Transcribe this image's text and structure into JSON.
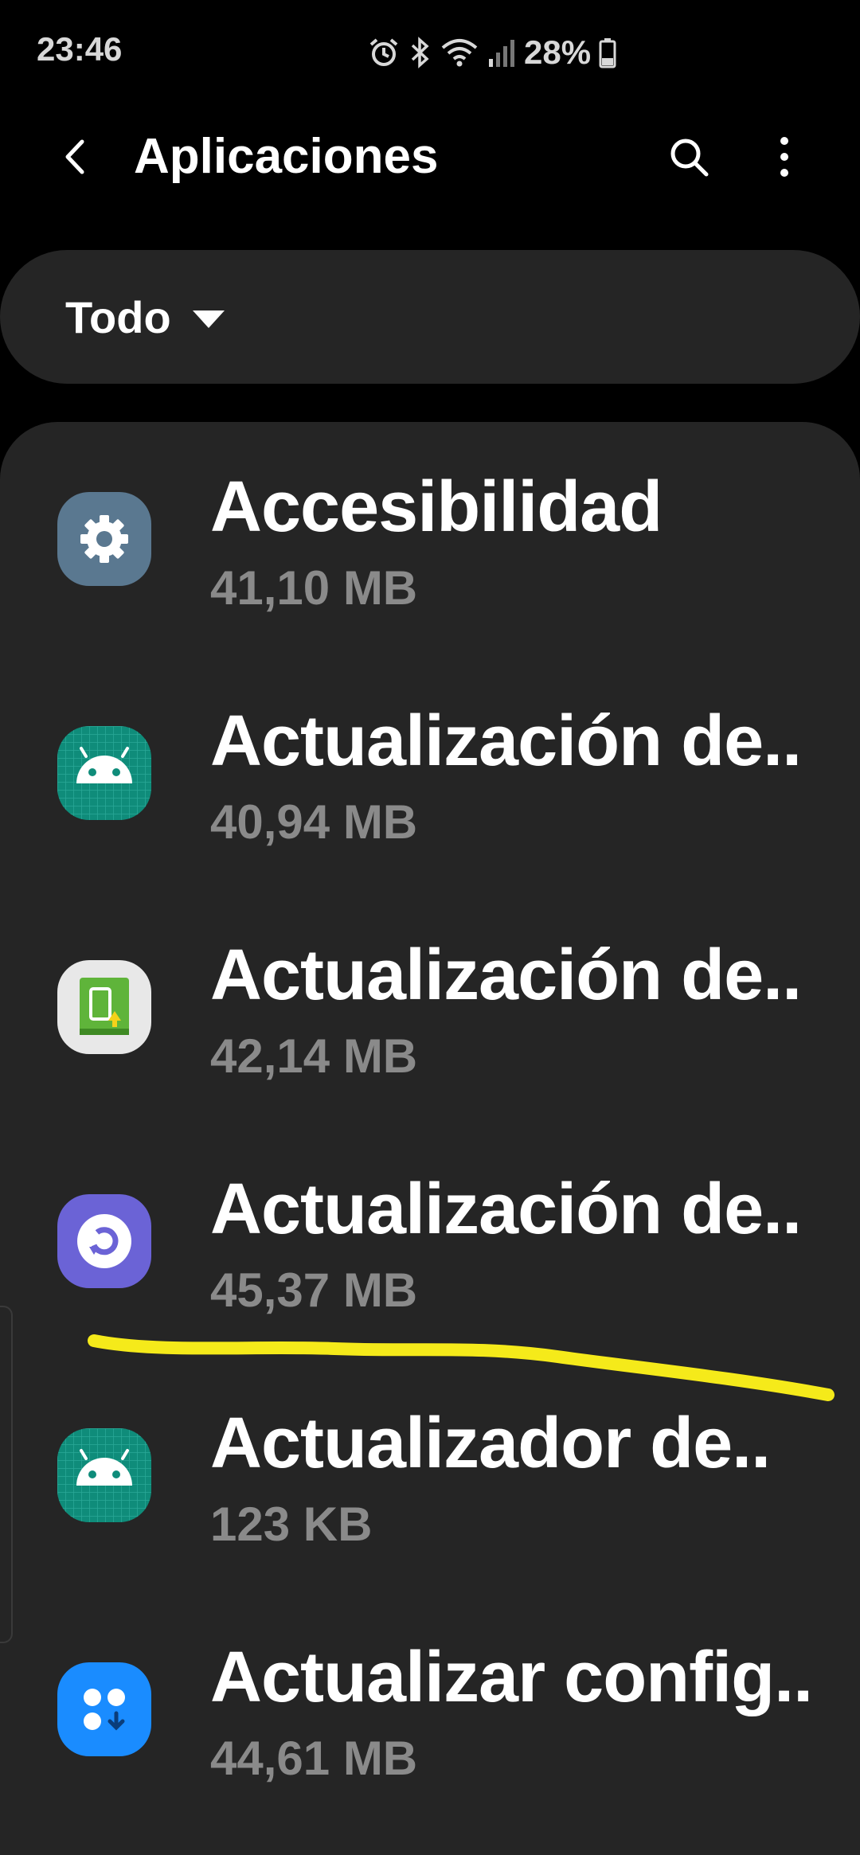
{
  "status_bar": {
    "time": "23:46",
    "battery_percent": "28%",
    "icons": [
      "alarm-icon",
      "bluetooth-icon",
      "wifi-icon",
      "signal-icon",
      "battery-icon"
    ]
  },
  "app_bar": {
    "title": "Aplicaciones",
    "icons": [
      "back-arrow-icon",
      "search-icon",
      "more-vert-icon"
    ]
  },
  "filter": {
    "selected": "Todo",
    "icon": "dropdown-caret-icon"
  },
  "apps": [
    {
      "name": "Accesibilidad",
      "size": "41,10 MB",
      "icon": "gear-icon",
      "icon_color": "#5a7890"
    },
    {
      "name": "Actualización de..",
      "size": "40,94 MB",
      "icon": "android-icon",
      "icon_color": "#0f8c7a"
    },
    {
      "name": "Actualización de..",
      "size": "42,14 MB",
      "icon": "package-update-icon",
      "icon_color": "#e8e8e8"
    },
    {
      "name": "Actualización de..",
      "size": "45,37 MB",
      "icon": "refresh-icon",
      "icon_color": "#6b63d6"
    },
    {
      "name": "Actualizador de..",
      "size": "123 KB",
      "icon": "android-icon",
      "icon_color": "#0f8c7a"
    },
    {
      "name": "Actualizar config..",
      "size": "44,61 MB",
      "icon": "config-download-icon",
      "icon_color": "#1a8cff"
    }
  ],
  "annotation_color": "#f5ea1a"
}
